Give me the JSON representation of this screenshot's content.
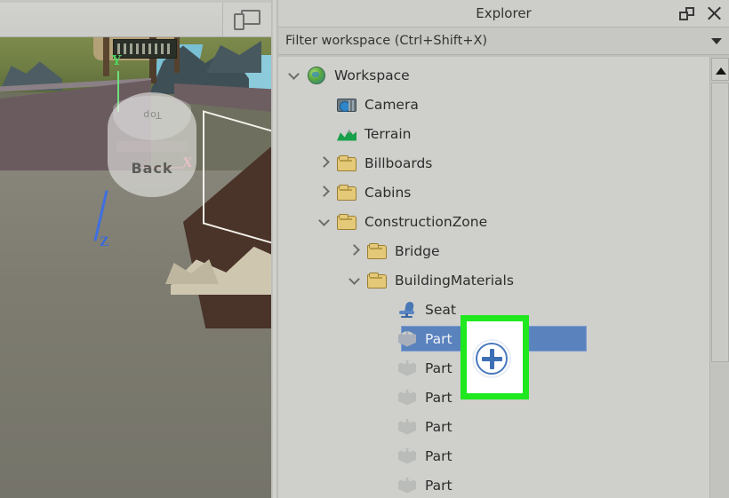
{
  "viewport": {
    "toolbar": {
      "device_button_icon": "device-preview-icon"
    },
    "gizmo": {
      "cube_top_label": "Top",
      "cube_back_label": "Back",
      "axis_y_label": "Y",
      "axis_x_label": "X",
      "axis_z_label": "Z"
    }
  },
  "explorer": {
    "title": "Explorer",
    "restore_icon": "restore-window-icon",
    "close_icon": "close-icon",
    "filter": {
      "value": "",
      "placeholder": "Filter workspace (Ctrl+Shift+X)",
      "dropdown_icon": "chevron-down-icon"
    },
    "tree": [
      {
        "label": "Workspace",
        "icon": "globe-icon",
        "depth": 0,
        "twisty": "open",
        "selected": false
      },
      {
        "label": "Camera",
        "icon": "camera-icon",
        "depth": 1,
        "twisty": "none",
        "selected": false
      },
      {
        "label": "Terrain",
        "icon": "terrain-icon",
        "depth": 1,
        "twisty": "none",
        "selected": false
      },
      {
        "label": "Billboards",
        "icon": "folder-icon",
        "depth": 1,
        "twisty": "closed",
        "selected": false
      },
      {
        "label": "Cabins",
        "icon": "folder-icon",
        "depth": 1,
        "twisty": "closed",
        "selected": false
      },
      {
        "label": "ConstructionZone",
        "icon": "folder-icon",
        "depth": 1,
        "twisty": "open",
        "selected": false
      },
      {
        "label": "Bridge",
        "icon": "folder-icon",
        "depth": 2,
        "twisty": "closed",
        "selected": false
      },
      {
        "label": "BuildingMaterials",
        "icon": "folder-icon",
        "depth": 2,
        "twisty": "open",
        "selected": false
      },
      {
        "label": "Seat",
        "icon": "seat-icon",
        "depth": 3,
        "twisty": "none",
        "selected": false
      },
      {
        "label": "Part",
        "icon": "part-icon",
        "depth": 3,
        "twisty": "none",
        "selected": true
      },
      {
        "label": "Part",
        "icon": "part-icon",
        "depth": 3,
        "twisty": "none",
        "selected": false
      },
      {
        "label": "Part",
        "icon": "part-icon",
        "depth": 3,
        "twisty": "none",
        "selected": false
      },
      {
        "label": "Part",
        "icon": "part-icon",
        "depth": 3,
        "twisty": "none",
        "selected": false
      },
      {
        "label": "Part",
        "icon": "part-icon",
        "depth": 3,
        "twisty": "none",
        "selected": false
      },
      {
        "label": "Part",
        "icon": "part-icon",
        "depth": 3,
        "twisty": "none",
        "selected": false
      }
    ],
    "scrollbar": {
      "up_arrow_icon": "triangle-up-icon"
    }
  },
  "annotation": {
    "highlight_color": "#1fe81f",
    "cursor_icon": "plus-cursor-icon",
    "cursor_color": "#3d6fb4"
  },
  "colors": {
    "panel_bg": "#cfcfcb",
    "selection_blue": "#5a82bd",
    "folder_gold": "#e3c978",
    "terrain_green": "#18a04a"
  }
}
